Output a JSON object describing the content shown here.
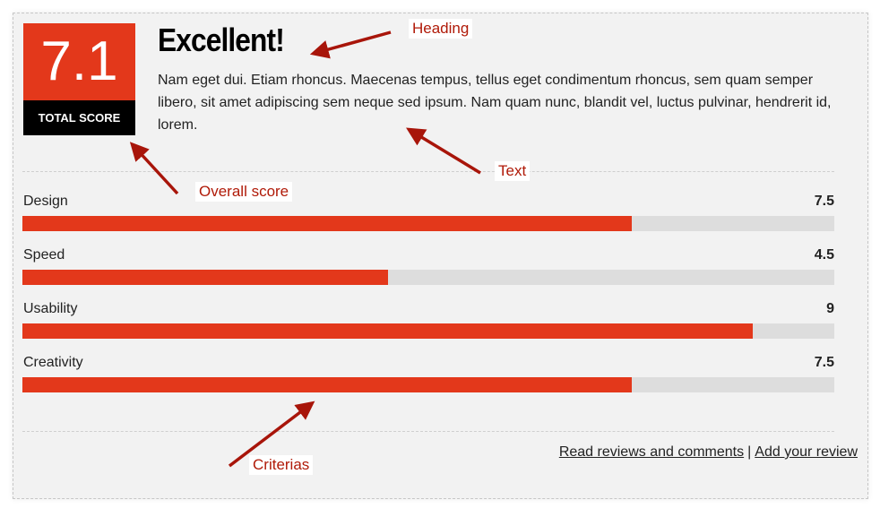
{
  "overall": {
    "score": "7.1",
    "label": "TOTAL SCORE"
  },
  "heading": "Excellent!",
  "description": "Nam eget dui. Etiam rhoncus. Maecenas tempus, tellus eget condimentum rhoncus, sem quam semper libero, sit amet adipiscing sem neque sed ipsum. Nam quam nunc, blandit vel, luctus pulvinar, hendrerit id, lorem.",
  "criteria": [
    {
      "name": "Design",
      "score": "7.5",
      "fraction": 0.75
    },
    {
      "name": "Speed",
      "score": "4.5",
      "fraction": 0.45
    },
    {
      "name": "Usability",
      "score": "9",
      "fraction": 0.9
    },
    {
      "name": "Creativity",
      "score": "7.5",
      "fraction": 0.75
    }
  ],
  "footer": {
    "read_reviews": "Read reviews and comments",
    "separator": "|",
    "add_review": "Add your review"
  },
  "callouts": {
    "heading": "Heading",
    "text": "Text",
    "overall": "Overall score",
    "criterias": "Criterias"
  },
  "colors": {
    "accent": "#e3381b",
    "track": "#dddddd",
    "callout_text": "#b01a08",
    "arrow": "#a8150a"
  }
}
